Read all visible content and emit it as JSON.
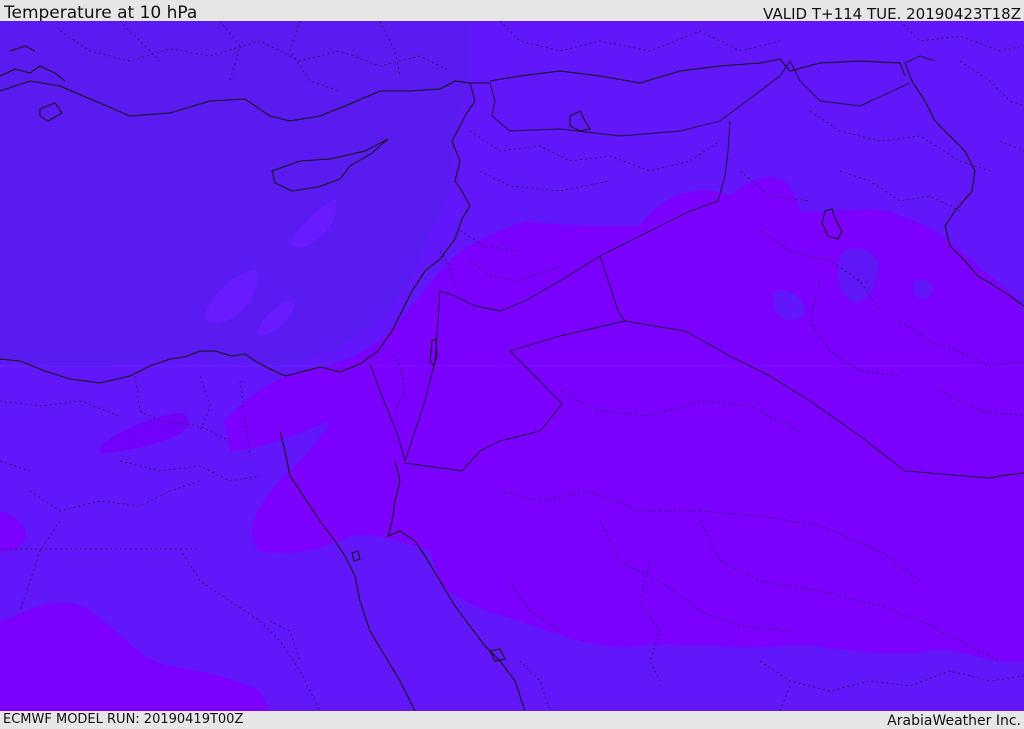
{
  "header": {
    "title": "Temperature at 10 hPa",
    "valid_time": "VALID T+114 TUE. 20190423T18Z"
  },
  "footer": {
    "model_run": "ECMWF MODEL RUN: 20190419T00Z",
    "credit": "ArabiaWeather Inc."
  },
  "map": {
    "field": "temperature",
    "level": "10 hPa",
    "colors": {
      "band_warm": "#7b00ff",
      "band_mid": "#6217fb",
      "band_cool": "#5a1cf0",
      "coastline": "#111111",
      "border": "#1a0a3a"
    }
  }
}
